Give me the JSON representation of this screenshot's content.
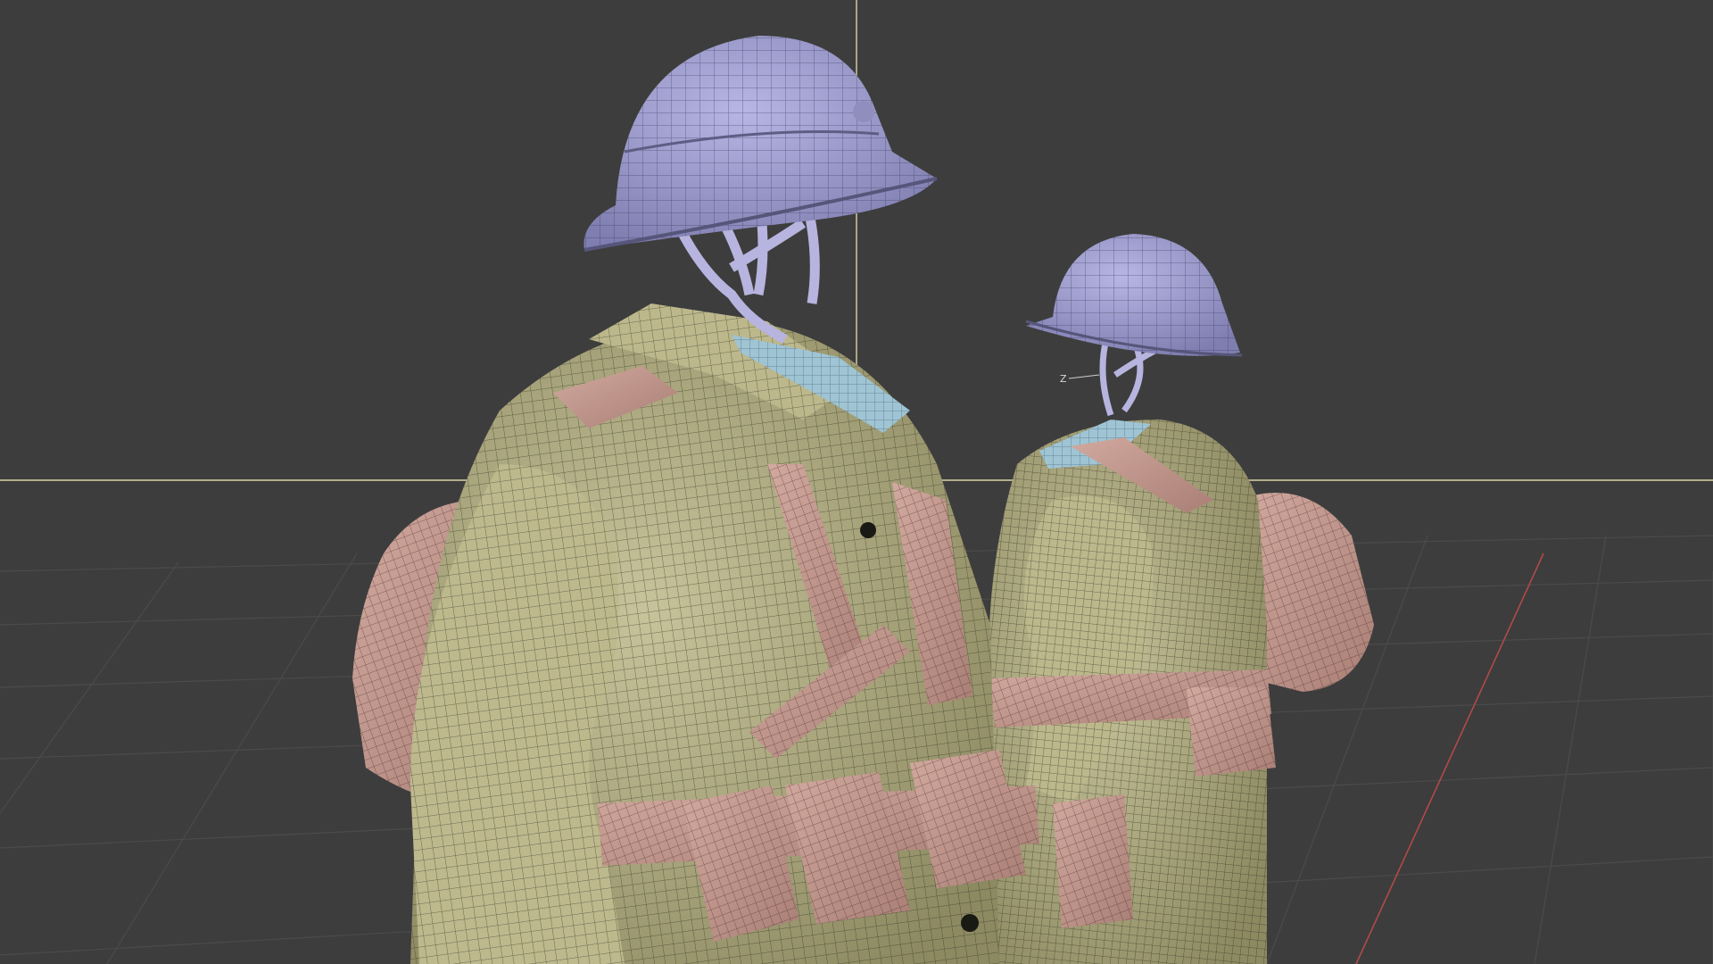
{
  "viewport": {
    "background_color": "#3d3d3d",
    "grid_color": "#4a4a4a",
    "x_axis_color": "#c05050",
    "cursor_crosshair_color": "#d9d3a6",
    "gizmo_axis_label": "Z"
  },
  "scene": {
    "objects": [
      {
        "name": "helmet",
        "color": "#a7a6d6"
      },
      {
        "name": "coat",
        "color": "#b6b284"
      },
      {
        "name": "webbing-straps-and-pouches",
        "color": "#c59b91"
      },
      {
        "name": "collar",
        "color": "#9fc4d4"
      }
    ]
  }
}
